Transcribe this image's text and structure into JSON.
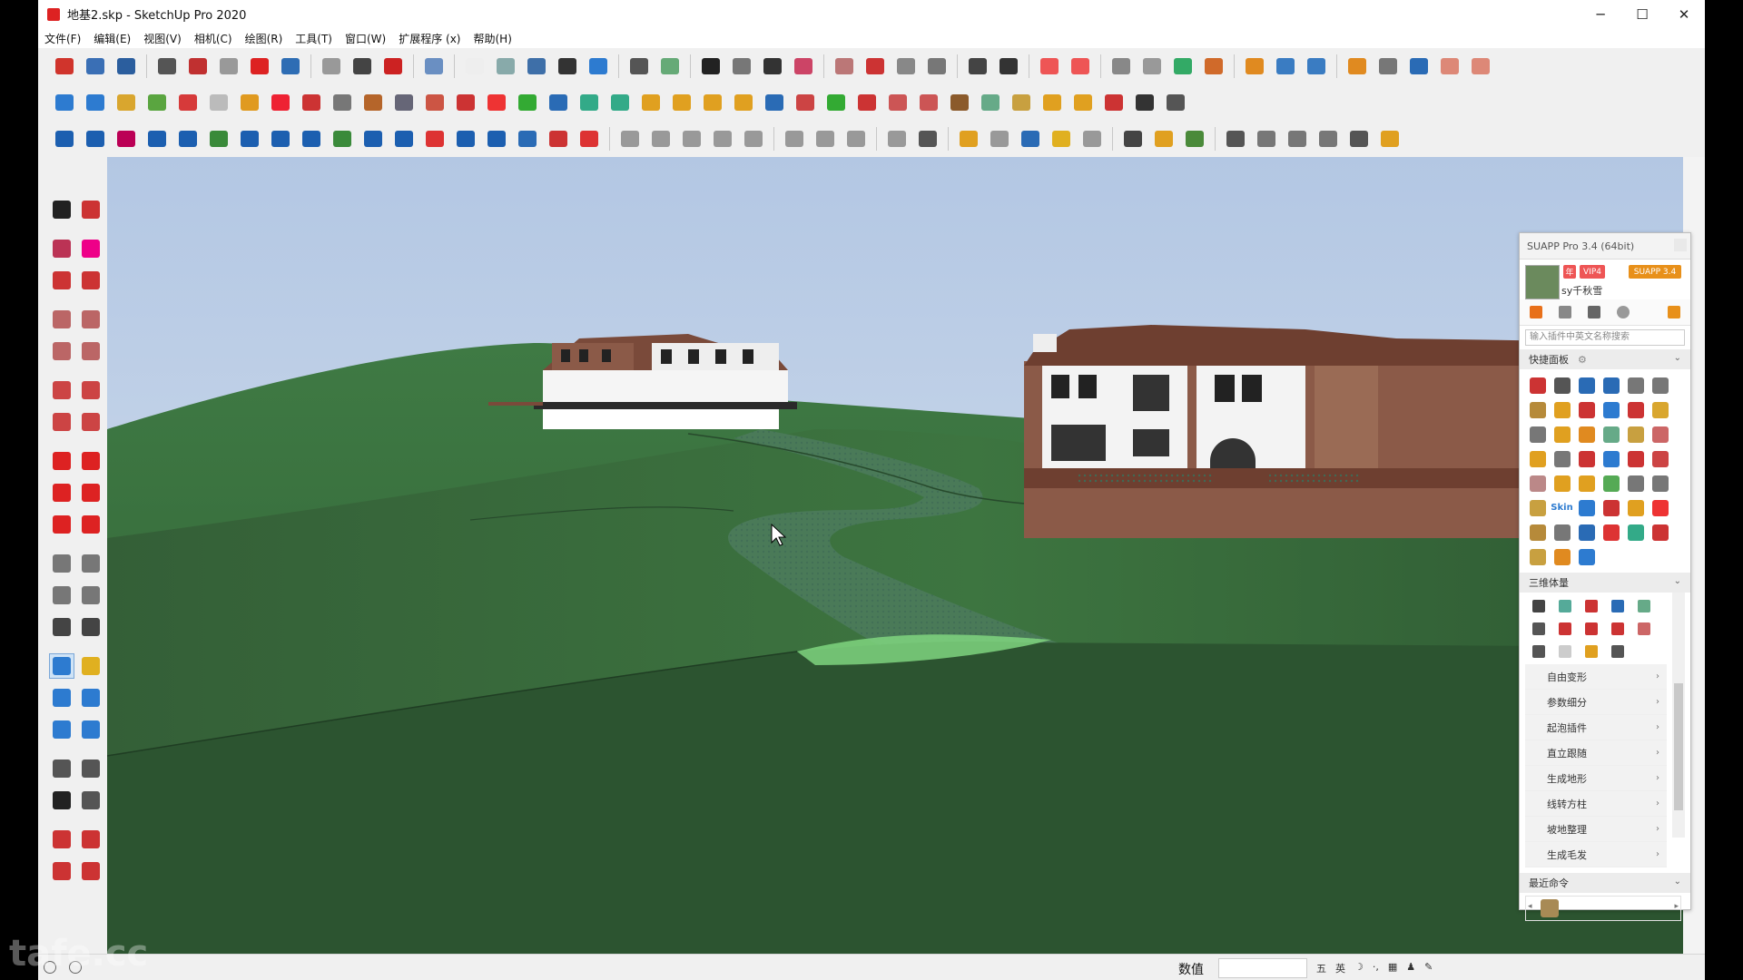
{
  "window": {
    "title": "地基2.skp - SketchUp Pro 2020",
    "minimize": "─",
    "maximize": "☐",
    "close": "✕"
  },
  "menu": [
    "文件(F)",
    "编辑(E)",
    "视图(V)",
    "相机(C)",
    "绘图(R)",
    "工具(T)",
    "窗口(W)",
    "扩展程序 (x)",
    "帮助(H)"
  ],
  "toolbars": {
    "row1": [
      "#d0342c",
      "#3a6fb5",
      "#2b5e9e",
      "#555",
      "#c03030",
      "#999",
      "#d22",
      "#2e6db4",
      "#999",
      "#444",
      "#c22",
      "#6a8fc2",
      "#eee",
      "#8aa",
      "#3e6fa8",
      "#333",
      "#2d7bd0",
      "#555",
      "#6a7",
      "#222",
      "#777",
      "#333",
      "#c46",
      "#b77",
      "#c33",
      "#888",
      "#777",
      "#444",
      "#333",
      "#e55",
      "#e55",
      "#888",
      "#999",
      "#3a6",
      "#d06a2a",
      "#e08a20",
      "#3a7cc2",
      "#3a7cc2",
      "#e08a20",
      "#777",
      "#2a6bb5",
      "#d87",
      "#d87"
    ],
    "row2": [
      "#2d7bd0",
      "#2d7bd0",
      "#d9a62e",
      "#5aa540",
      "#d63a3a",
      "#bbb",
      "#e09a20",
      "#e23",
      "#c33",
      "#777",
      "#b5652a",
      "#667",
      "#c54",
      "#c33",
      "#e33",
      "#3a3",
      "#2a6bb5",
      "#3a8",
      "#3a8",
      "#e0a020",
      "#e0a020",
      "#e0a020",
      "#e0a020",
      "#2a6bb5",
      "#c44",
      "#3a3",
      "#c33",
      "#c55",
      "#c55",
      "#8b5a2b",
      "#6a8",
      "#c8a040",
      "#e0a020",
      "#e0a020",
      "#c33",
      "#333",
      "#555"
    ],
    "row3": [
      "#1c5fb0",
      "#1c5fb0",
      "#b05",
      "#1c5fb0",
      "#1c5fb0",
      "#3a8a3a",
      "#1c5fb0",
      "#1c5fb0",
      "#1c5fb0",
      "#3a8a3a",
      "#1c5fb0",
      "#1c5fb0",
      "#d33",
      "#1c5fb0",
      "#1c5fb0",
      "#2a6bb5",
      "#c33",
      "#d33",
      "#999",
      "#999",
      "#999",
      "#999",
      "#999",
      "#999",
      "#999",
      "#999",
      "#999",
      "#555",
      "#e0a020",
      "#999",
      "#2a6bb5",
      "#e0b020",
      "#999",
      "#444",
      "#e0a020",
      "#4a8a3a",
      "#555",
      "#777",
      "#777",
      "#777",
      "#555",
      "#e0a020"
    ]
  },
  "left_tools": [
    {
      "name": "select-tool",
      "c": "#222"
    },
    {
      "name": "component-tool",
      "c": "#c33"
    },
    {
      "name": "paint-bucket-tool",
      "c": "#b35"
    },
    {
      "name": "eraser-tool",
      "c": "#e08"
    },
    {
      "name": "line-tool",
      "c": "#c33"
    },
    {
      "name": "freehand-tool",
      "c": "#c33"
    },
    {
      "name": "rectangle-tool",
      "c": "#b66"
    },
    {
      "name": "rotated-rectangle-tool",
      "c": "#b66"
    },
    {
      "name": "circle-tool",
      "c": "#b66"
    },
    {
      "name": "polygon-tool",
      "c": "#b66"
    },
    {
      "name": "arc-tool",
      "c": "#c44"
    },
    {
      "name": "two-point-arc-tool",
      "c": "#c44"
    },
    {
      "name": "three-point-arc-tool",
      "c": "#c44"
    },
    {
      "name": "pie-tool",
      "c": "#c44"
    },
    {
      "name": "move-tool",
      "c": "#d22"
    },
    {
      "name": "push-pull-tool",
      "c": "#d22"
    },
    {
      "name": "rotate-tool",
      "c": "#d22"
    },
    {
      "name": "follow-me-tool",
      "c": "#d22"
    },
    {
      "name": "scale-tool",
      "c": "#d22"
    },
    {
      "name": "offset-tool",
      "c": "#d22"
    },
    {
      "name": "tape-measure-tool",
      "c": "#777"
    },
    {
      "name": "dimension-tool",
      "c": "#777"
    },
    {
      "name": "protractor-tool",
      "c": "#777"
    },
    {
      "name": "text-tool",
      "c": "#777"
    },
    {
      "name": "axes-tool",
      "c": "#444"
    },
    {
      "name": "3d-text-tool",
      "c": "#444"
    },
    {
      "name": "orbit-tool",
      "c": "#2d7bd0"
    },
    {
      "name": "pan-tool",
      "c": "#e0b020"
    },
    {
      "name": "zoom-tool",
      "c": "#2d7bd0"
    },
    {
      "name": "zoom-window-tool",
      "c": "#2d7bd0"
    },
    {
      "name": "zoom-extents-tool",
      "c": "#2d7bd0"
    },
    {
      "name": "previous-view-tool",
      "c": "#2d7bd0"
    },
    {
      "name": "position-camera-tool",
      "c": "#555"
    },
    {
      "name": "look-around-tool",
      "c": "#555"
    },
    {
      "name": "walk-tool",
      "c": "#222"
    },
    {
      "name": "section-plane-tool",
      "c": "#555"
    },
    {
      "name": "warehouse-tool",
      "c": "#c33"
    },
    {
      "name": "extension-warehouse-tool",
      "c": "#c33"
    },
    {
      "name": "layout-tool",
      "c": "#c33"
    },
    {
      "name": "share-model-tool",
      "c": "#c33"
    }
  ],
  "suapp": {
    "title": "SUAPP Pro 3.4 (64bit)",
    "badge_year": "年",
    "badge_vip": "VIP4",
    "badge_brand": "SUAPP 3.4",
    "username": "sy千秋雪",
    "search_placeholder": "输入插件中英文名称搜索",
    "quick_panel": "快捷面板",
    "quick_panel_gear": "⚙",
    "skin_label": "Skin",
    "section_3d": "三维体量",
    "menu_items": [
      "自由变形",
      "参数细分",
      "起泡插件",
      "直立跟随",
      "生成地形",
      "线转方柱",
      "坡地整理",
      "生成毛发"
    ],
    "recent": "最近命令",
    "quick_icons": [
      "#c33",
      "#555",
      "#2a6bb5",
      "#2a6bb5",
      "#777",
      "#777",
      "#b68a3a",
      "#e0a020",
      "#c33",
      "#2d7bd0",
      "#c33",
      "#d9a62e",
      "#777",
      "#e0a020",
      "#e08a20",
      "#6a8",
      "#c8a040",
      "#c66",
      "#e0a020",
      "#777",
      "#c33",
      "#2d7bd0",
      "#c33",
      "#c44",
      "#b88",
      "#e0a020",
      "#e0a020",
      "#5a5",
      "#777",
      "#777",
      "#c8a040",
      "#3a6",
      "#2d7bd0",
      "#c33",
      "#e0a020",
      "#e33",
      "#b68a3a",
      "#777",
      "#2a6bb5",
      "#d33",
      "#3a8",
      "#c33",
      "#c8a040",
      "#e08a20",
      "#2d7bd0"
    ],
    "small_icons": [
      "#444",
      "#5a9",
      "#c33",
      "#2a6bb5",
      "#6a8",
      "#555",
      "#c33",
      "#c33",
      "#c33",
      "#c66",
      "#555",
      "#ccc",
      "#e0a020",
      "#555"
    ]
  },
  "status": {
    "label": "数值",
    "value": "",
    "ime": [
      "五",
      "英",
      "☽",
      "·,",
      "▦",
      "♟",
      "✎"
    ]
  },
  "watermark": "tafe.cc",
  "icons": {
    "orbit-active": "orbit-tool",
    "cursor": "arrow-cursor"
  }
}
